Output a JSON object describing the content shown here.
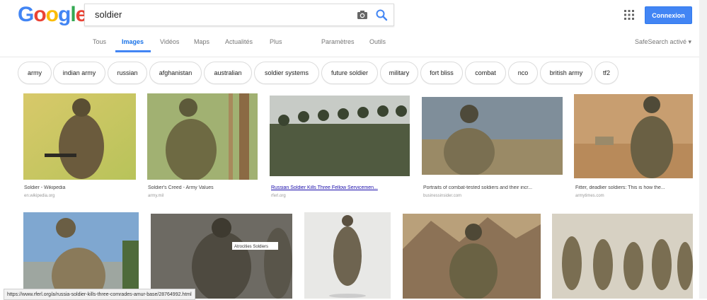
{
  "search": {
    "query": "soldier",
    "logo_letters": [
      {
        "ch": "G",
        "color": "#4285f4"
      },
      {
        "ch": "o",
        "color": "#ea4335"
      },
      {
        "ch": "o",
        "color": "#fbbc05"
      },
      {
        "ch": "g",
        "color": "#4285f4"
      },
      {
        "ch": "l",
        "color": "#34a853"
      },
      {
        "ch": "e",
        "color": "#ea4335"
      }
    ]
  },
  "header": {
    "signin_label": "Connexion",
    "tabs": [
      "Tous",
      "Images",
      "Vidéos",
      "Maps",
      "Actualités",
      "Plus",
      "Paramètres",
      "Outils"
    ],
    "active_tab": "Images",
    "safesearch": "SafeSearch activé ▾"
  },
  "chips": [
    "army",
    "indian army",
    "russian",
    "afghanistan",
    "australian",
    "soldier systems",
    "future soldier",
    "military",
    "fort bliss",
    "combat",
    "nco",
    "british army",
    "tf2"
  ],
  "results_row1": [
    {
      "title": "Soldier - Wikipedia",
      "source": "en.wikipedia.org"
    },
    {
      "title": "Soldier's Creed - Army Values",
      "source": "army.mil"
    },
    {
      "title": "Russian Soldier Kills Three Fellow Servicemen...",
      "source": "rferl.org"
    },
    {
      "title": "Portraits of combat-tested soldiers and their incr...",
      "source": "businessinsider.com"
    },
    {
      "title": "Fitter, deadlier soldiers: This is how the...",
      "source": "armytimes.com"
    }
  ],
  "results_row2_overlay": "Atrocities Soldiers",
  "status_url": "https://www.rferl.org/a/russia-soldier-kills-three-comrades-amur-base/28764992.html",
  "colors": {
    "accent": "#4285f4",
    "link": "#1a0dab"
  }
}
